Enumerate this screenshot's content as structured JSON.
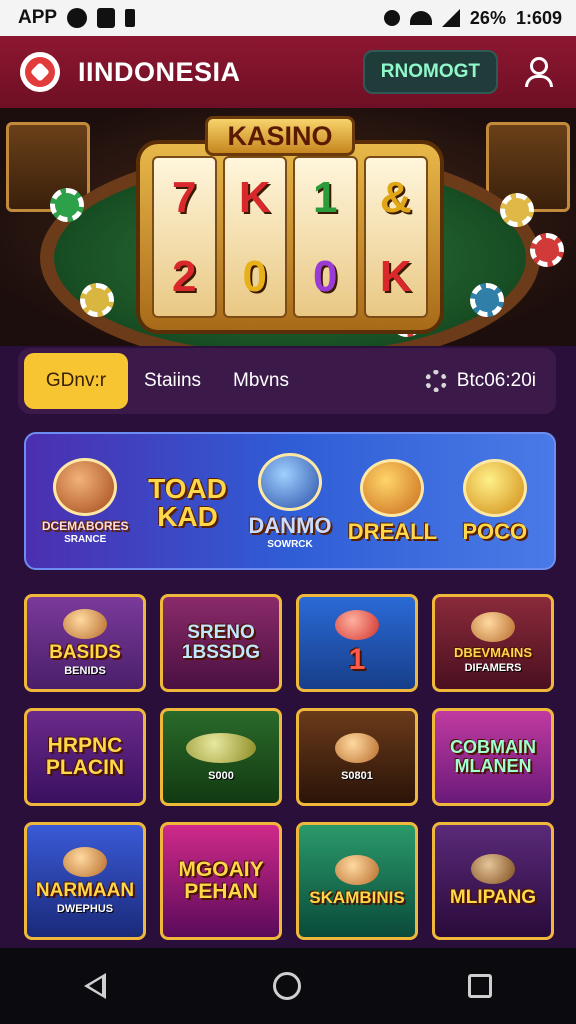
{
  "status_bar": {
    "app_label": "APP",
    "battery": "26%",
    "time": "1:609"
  },
  "header": {
    "brand": "IINDONESIA",
    "button_label": "RNOMOGT"
  },
  "hero": {
    "title": "KASINO",
    "reels": [
      {
        "top": "7",
        "bottom": "2"
      },
      {
        "top": "K",
        "bottom": "0"
      },
      {
        "top": "1",
        "bottom": "0"
      },
      {
        "top": "&",
        "bottom": "K"
      }
    ]
  },
  "tabs": {
    "items": [
      {
        "label": "GDnv:r"
      },
      {
        "label": "Staiins"
      },
      {
        "label": "Mbvns"
      }
    ],
    "balance": "Btc06:20i"
  },
  "promo": {
    "items": [
      {
        "label": "DCEMABORES",
        "sub": "SRANCE"
      },
      {
        "label": "TOAD KAD",
        "sub": ""
      },
      {
        "label": "DANMO",
        "sub": "SOWRCK"
      },
      {
        "label": "DREALL",
        "sub": ""
      },
      {
        "label": "POCO",
        "sub": ""
      }
    ]
  },
  "games": [
    {
      "title": "BASIDS",
      "sub": "BENIDS"
    },
    {
      "title": "SRENO 1BSSDG",
      "sub": ""
    },
    {
      "title": "1",
      "sub": ""
    },
    {
      "title": "DBEVMAINS",
      "sub": "DIFAMERS"
    },
    {
      "title": "HRPNC PLACIN",
      "sub": ""
    },
    {
      "title": "",
      "sub": "S000"
    },
    {
      "title": "",
      "sub": "S0801"
    },
    {
      "title": "COBMAIN MLANEN",
      "sub": ""
    },
    {
      "title": "NARMAAN",
      "sub": "DWEPHUS"
    },
    {
      "title": "MGOAIY PEHAN",
      "sub": ""
    },
    {
      "title": "SKAMBINIS",
      "sub": ""
    },
    {
      "title": "MLIPANG",
      "sub": ""
    }
  ],
  "colors": {
    "header": "#7a1229",
    "accent": "#f7c531",
    "page_bg": "#2a0f3a",
    "promo_bg": "#2f5dd6",
    "tile_border": "#f0b83a"
  }
}
